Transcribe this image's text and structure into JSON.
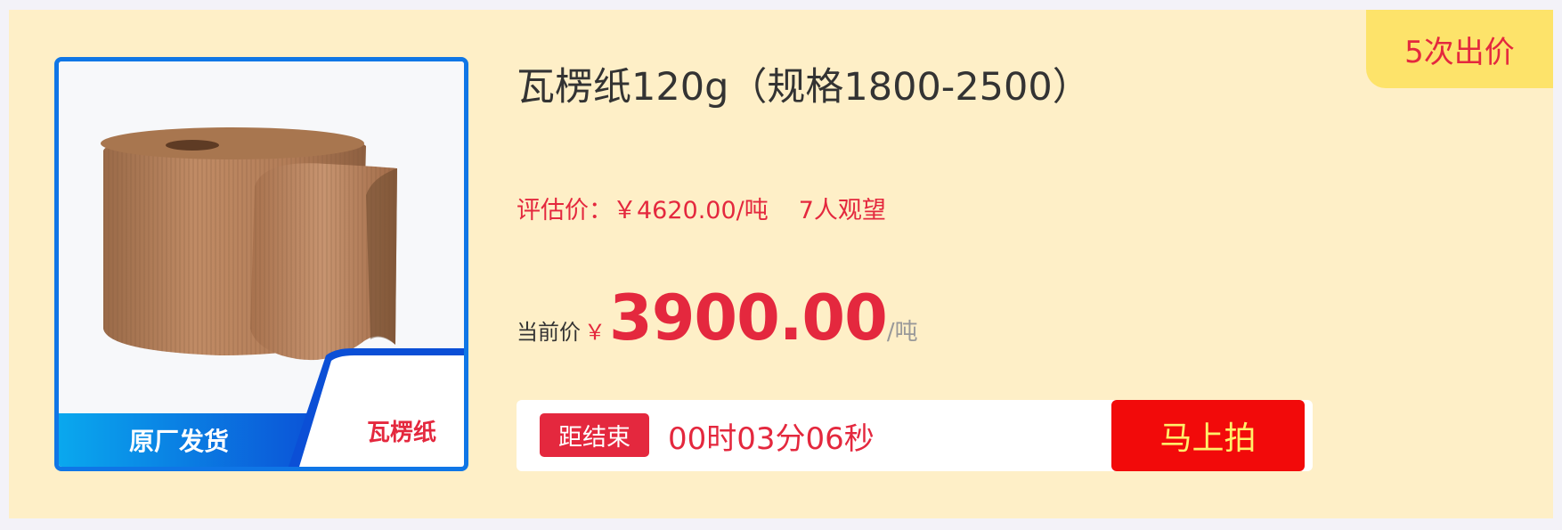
{
  "badge": {
    "bid_count": "5次出价"
  },
  "product": {
    "title": "瓦楞纸120g（规格1800-2500）",
    "image": {
      "banner_left": "原厂发货",
      "banner_right": "瓦楞纸"
    },
    "estimate": {
      "label": "评估价：",
      "value": "￥4620.00/吨",
      "watchers": "7人观望"
    },
    "current_price": {
      "label": "当前价",
      "currency": "￥",
      "value": "3900.00",
      "unit": "/吨"
    }
  },
  "countdown": {
    "label": "距结束",
    "time": "00时03分06秒"
  },
  "action": {
    "bid_label": "马上拍"
  },
  "colors": {
    "background": "#feefc7",
    "accent_red": "#e4283e",
    "button_red": "#f20a0a",
    "badge_yellow": "#fde36a",
    "image_frame_blue": "#0f76e6"
  }
}
